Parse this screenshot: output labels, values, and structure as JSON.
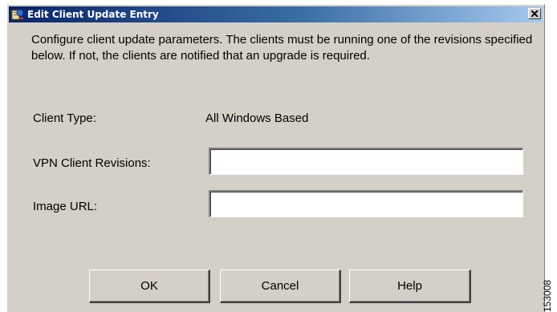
{
  "window": {
    "title": "Edit Client Update Entry",
    "icon": "app-icon",
    "close_icon": "close-icon"
  },
  "description": "Configure client update parameters.  The clients must be running one of the revisions specified below.  If not, the clients are notified that an upgrade is required.",
  "form": {
    "client_type_label": "Client Type:",
    "client_type_value": "All Windows Based",
    "vpn_revisions_label": "VPN Client Revisions:",
    "vpn_revisions_value": "",
    "image_url_label": "Image URL:",
    "image_url_value": ""
  },
  "buttons": {
    "ok": "OK",
    "cancel": "Cancel",
    "help": "Help"
  },
  "figure_id": "153008",
  "colors": {
    "dialog_bg": "#d4d0c8",
    "titlebar_start": "#0a246a",
    "titlebar_end": "#a6caf0"
  }
}
